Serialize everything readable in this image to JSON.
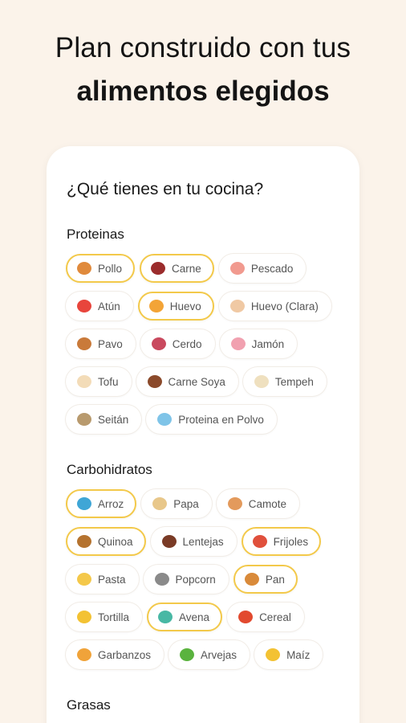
{
  "headline": {
    "line1": "Plan construido con tus",
    "line2": "alimentos elegidos"
  },
  "card": {
    "title": "¿Qué tienes en tu cocina?"
  },
  "sections": [
    {
      "title": "Proteinas",
      "items": [
        {
          "label": "Pollo",
          "icon": "chicken-leg-icon",
          "color": "#e08a3c",
          "selected": true
        },
        {
          "label": "Carne",
          "icon": "steak-icon",
          "color": "#9b2c2c",
          "selected": true
        },
        {
          "label": "Pescado",
          "icon": "fish-icon",
          "color": "#f19a8f",
          "selected": false
        },
        {
          "label": "Atún",
          "icon": "tuna-can-icon",
          "color": "#e8453c",
          "selected": false
        },
        {
          "label": "Huevo",
          "icon": "egg-icon",
          "color": "#f3a437",
          "selected": true
        },
        {
          "label": "Huevo (Clara)",
          "icon": "egg-white-icon",
          "color": "#f0c9a4",
          "selected": false
        },
        {
          "label": "Pavo",
          "icon": "turkey-icon",
          "color": "#c97a3a",
          "selected": false
        },
        {
          "label": "Cerdo",
          "icon": "pork-icon",
          "color": "#c9495e",
          "selected": false
        },
        {
          "label": "Jamón",
          "icon": "ham-icon",
          "color": "#f1a1b0",
          "selected": false
        },
        {
          "label": "Tofu",
          "icon": "tofu-icon",
          "color": "#f3dcb8",
          "selected": false
        },
        {
          "label": "Carne Soya",
          "icon": "soy-meat-icon",
          "color": "#8b4a2b",
          "selected": false
        },
        {
          "label": "Tempeh",
          "icon": "tempeh-icon",
          "color": "#efe0bf",
          "selected": false
        },
        {
          "label": "Seitán",
          "icon": "seitan-icon",
          "color": "#b89a6e",
          "selected": false
        },
        {
          "label": "Proteina en Polvo",
          "icon": "protein-shaker-icon",
          "color": "#7fc4e8",
          "selected": false
        }
      ]
    },
    {
      "title": "Carbohidratos",
      "items": [
        {
          "label": "Arroz",
          "icon": "rice-bowl-icon",
          "color": "#3fa6d6",
          "selected": true
        },
        {
          "label": "Papa",
          "icon": "potato-icon",
          "color": "#e8c78a",
          "selected": false
        },
        {
          "label": "Camote",
          "icon": "sweet-potato-icon",
          "color": "#e39a5c",
          "selected": false
        },
        {
          "label": "Quinoa",
          "icon": "quinoa-icon",
          "color": "#b5732f",
          "selected": true
        },
        {
          "label": "Lentejas",
          "icon": "lentils-icon",
          "color": "#7a3b26",
          "selected": false
        },
        {
          "label": "Frijoles",
          "icon": "beans-icon",
          "color": "#e0503c",
          "selected": true
        },
        {
          "label": "Pasta",
          "icon": "pasta-icon",
          "color": "#f4c84a",
          "selected": false
        },
        {
          "label": "Popcorn",
          "icon": "popcorn-icon",
          "color": "#8a8a8a",
          "selected": false
        },
        {
          "label": "Pan",
          "icon": "bread-icon",
          "color": "#d98a3a",
          "selected": true
        },
        {
          "label": "Tortilla",
          "icon": "tortilla-icon",
          "color": "#f3c233",
          "selected": false
        },
        {
          "label": "Avena",
          "icon": "oatmeal-bowl-icon",
          "color": "#48b8a4",
          "selected": true
        },
        {
          "label": "Cereal",
          "icon": "cereal-box-icon",
          "color": "#e24a2f",
          "selected": false
        },
        {
          "label": "Garbanzos",
          "icon": "chickpeas-icon",
          "color": "#f0a33a",
          "selected": false
        },
        {
          "label": "Arvejas",
          "icon": "peas-icon",
          "color": "#5ab33e",
          "selected": false
        },
        {
          "label": "Maíz",
          "icon": "corn-icon",
          "color": "#f3c233",
          "selected": false
        }
      ]
    },
    {
      "title": "Grasas",
      "items": []
    }
  ]
}
